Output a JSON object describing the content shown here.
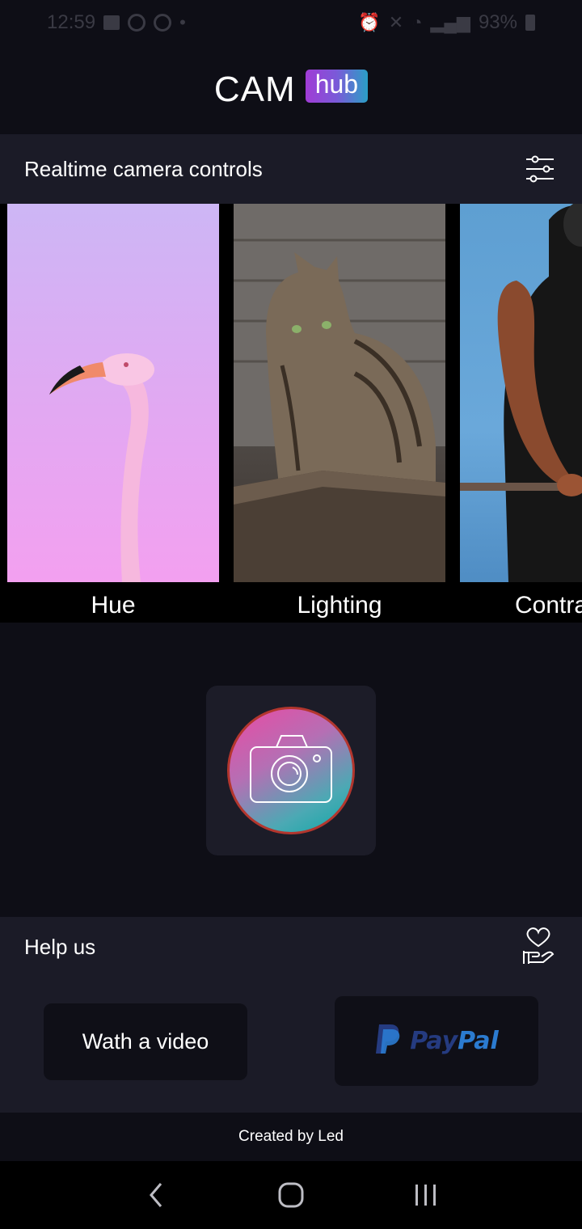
{
  "status_bar": {
    "time": "12:59",
    "battery": "93%"
  },
  "header": {
    "logo_main": "CAM",
    "logo_badge": "hub"
  },
  "controls": {
    "title": "Realtime camera controls",
    "settings_icon": "sliders-icon"
  },
  "carousel": {
    "cards": [
      {
        "label": "Hue",
        "image": "flamingo on pink background"
      },
      {
        "label": "Lighting",
        "image": "tabby cat in wooden box"
      },
      {
        "label": "Contra",
        "image": "muscular man on pull-up bar"
      }
    ]
  },
  "capture": {
    "icon": "camera-icon"
  },
  "help": {
    "title": "Help us",
    "icon": "heart-hand-icon",
    "video_button": "Wath a video",
    "paypal_pay": "Pay",
    "paypal_pal": "Pal"
  },
  "footer": {
    "text": "Created by Led"
  },
  "colors": {
    "background": "#0e0e16",
    "panel": "#1b1b27",
    "accent_pink": "#ea4aa4",
    "accent_teal": "#0fa8a6"
  }
}
